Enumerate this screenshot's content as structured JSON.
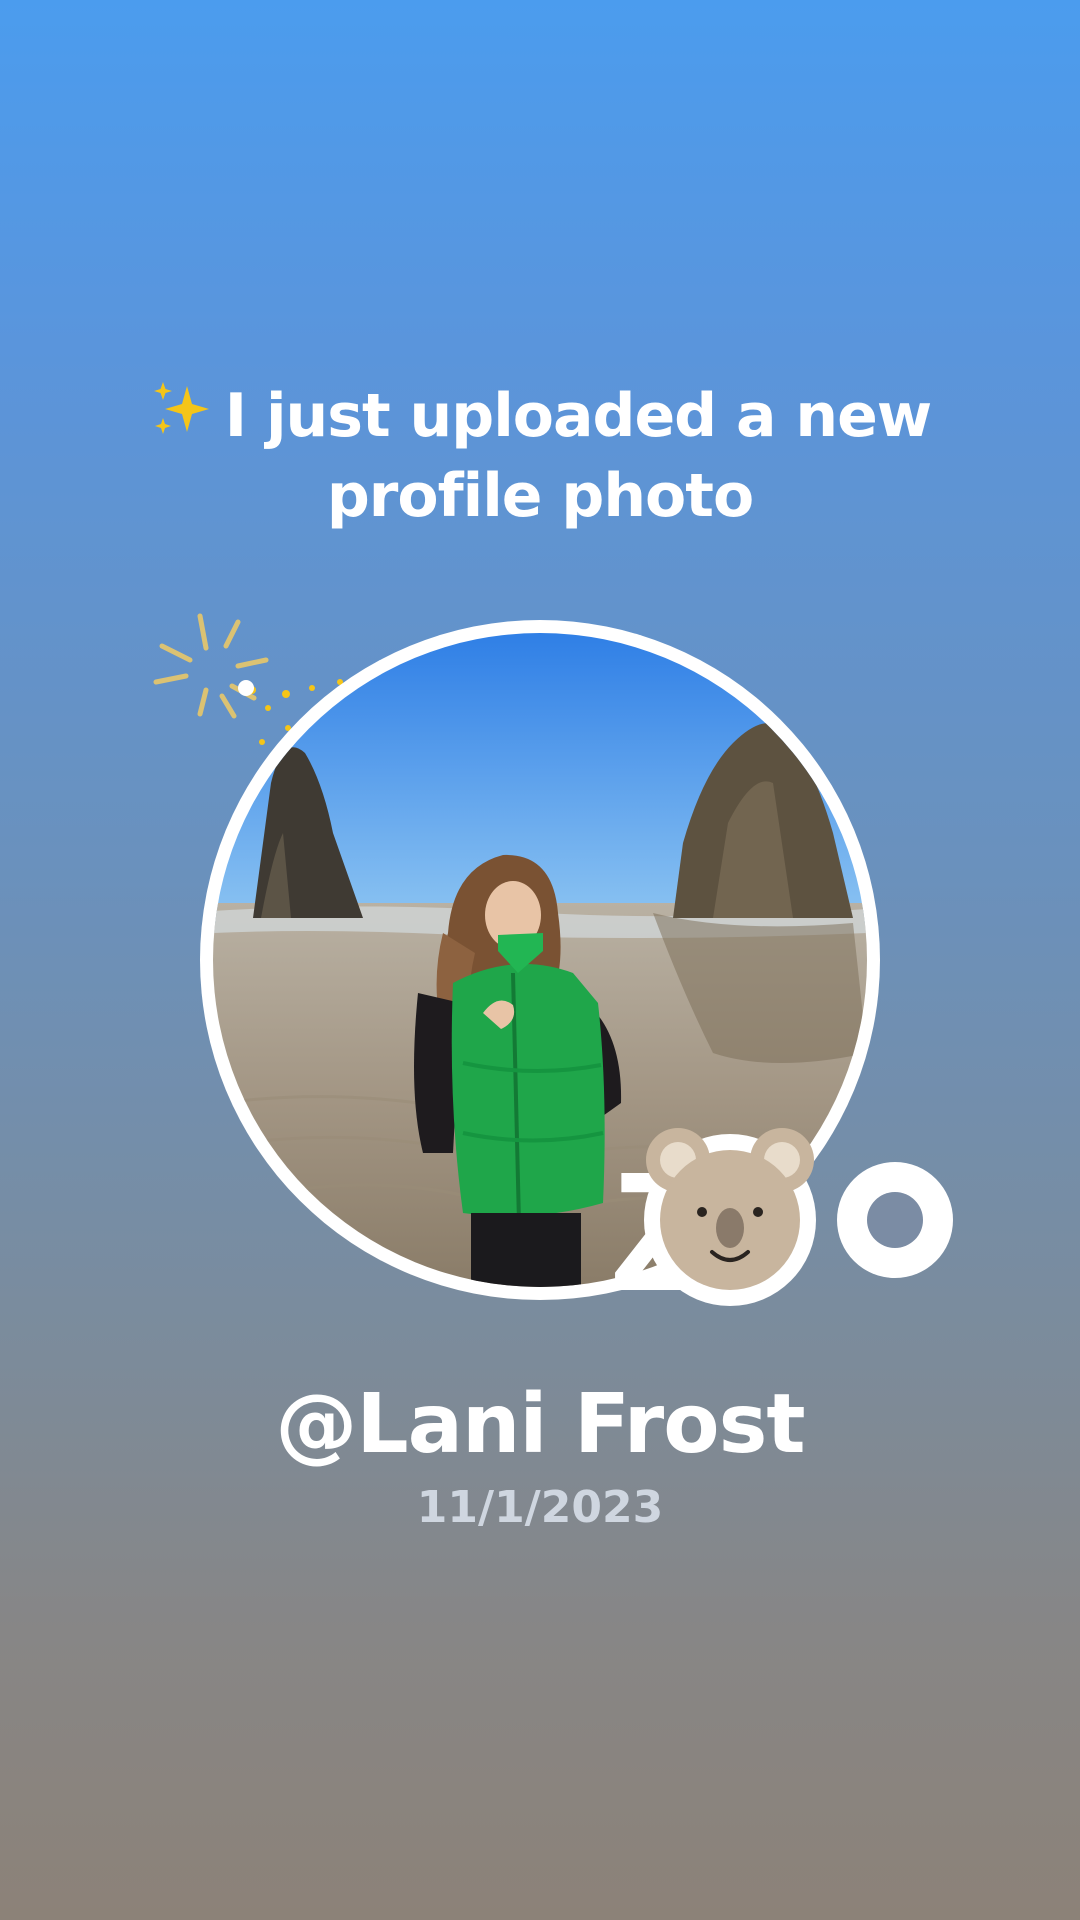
{
  "story": {
    "headline": {
      "emoji": "✨",
      "text": "I just uploaded a new profile photo"
    },
    "username": "@Lani Frost",
    "date": "11/1/2023",
    "sticker_text": "ZOO"
  },
  "icons": {
    "headline": "sparkles-icon",
    "decoration": "firework-burst-icon",
    "sticker": "koala-icon"
  },
  "colors": {
    "text": "#ffffff",
    "date": "#cfd6e0",
    "sparkle": "#f5c518",
    "vest": "#1fa64a"
  }
}
